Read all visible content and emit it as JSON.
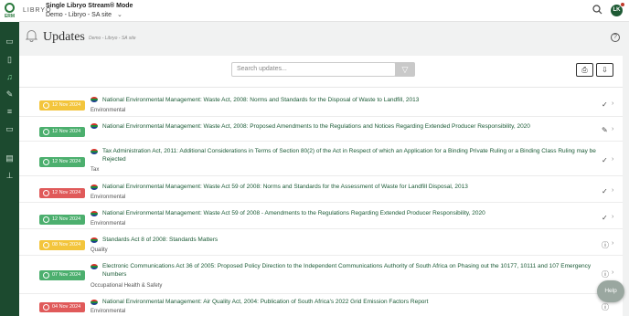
{
  "sidebar": {
    "logo_label": "ERM",
    "icons": [
      "briefcase-icon",
      "clipboard-icon",
      "bell-icon",
      "wrench-icon",
      "list-icon",
      "folder-icon",
      "document-icon",
      "org-chart-icon"
    ]
  },
  "topbar": {
    "brand": "LIBRYO",
    "mode": "Single Libryo Stream® Mode",
    "site": "Demo - Libryo - SA site",
    "avatar": "LK"
  },
  "header": {
    "title": "Updates",
    "breadcrumb": "Demo - Libryo - SA site",
    "help": "?"
  },
  "toolbar": {
    "search_placeholder": "Search updates..."
  },
  "colors": {
    "sidebar": "#1c4a2f",
    "badge_yellow": "#f3c53c",
    "badge_green": "#4caf6e",
    "badge_red": "#e05a5a",
    "title_green": "#1a5a35"
  },
  "rows": [
    {
      "date": "12 Nov 2024",
      "badge": "yellow",
      "title": "National Environmental Management: Waste Act, 2008: Norms and Standards for the Disposal of Waste to Landfill, 2013",
      "category": "Environmental",
      "status": "check-icon"
    },
    {
      "date": "12 Nov 2024",
      "badge": "green",
      "title": "National Environmental Management: Waste Act, 2008: Proposed Amendments to the Regulations and Notices Regarding Extended Producer Responsibility, 2020",
      "category": "",
      "status": "pencil-icon"
    },
    {
      "date": "12 Nov 2024",
      "badge": "green",
      "title": "Tax Administration Act, 2011: Additional Considerations in Terms of Section 80(2) of the Act in Respect of which an Application for a Binding Private Ruling or a Binding Class Ruling may be Rejected",
      "category": "Tax",
      "status": "check-icon"
    },
    {
      "date": "12 Nov 2024",
      "badge": "red",
      "title": "National Environmental Management: Waste Act 59 of 2008: Norms and Standards for the Assessment of Waste for Landfill Disposal, 2013",
      "category": "Environmental",
      "status": "check-icon"
    },
    {
      "date": "12 Nov 2024",
      "badge": "green",
      "title": "National Environmental Management: Waste Act 59 of 2008 - Amendments to the Regulations Regarding Extended Producer Responsibility, 2020",
      "category": "Environmental",
      "status": "check-icon"
    },
    {
      "date": "08 Nov 2024",
      "badge": "yellow",
      "title": "Standards Act 8 of 2008: Standards Matters",
      "category": "Quality",
      "status": "info-icon"
    },
    {
      "date": "07 Nov 2024",
      "badge": "green",
      "title": "Electronic Communications Act 36 of 2005: Proposed Policy Direction to the Independent Communications Authority of South Africa on Phasing out the 10177, 10111 and 107 Emergency Numbers",
      "category": "Occupational Health & Safety",
      "status": "info-icon"
    },
    {
      "date": "04 Nov 2024",
      "badge": "red",
      "title": "National Environmental Management: Air Quality Act, 2004: Publication of South Africa's 2022 Grid Emission Factors Report",
      "category": "Environmental",
      "status": "info-icon"
    }
  ],
  "help_button": "Help"
}
